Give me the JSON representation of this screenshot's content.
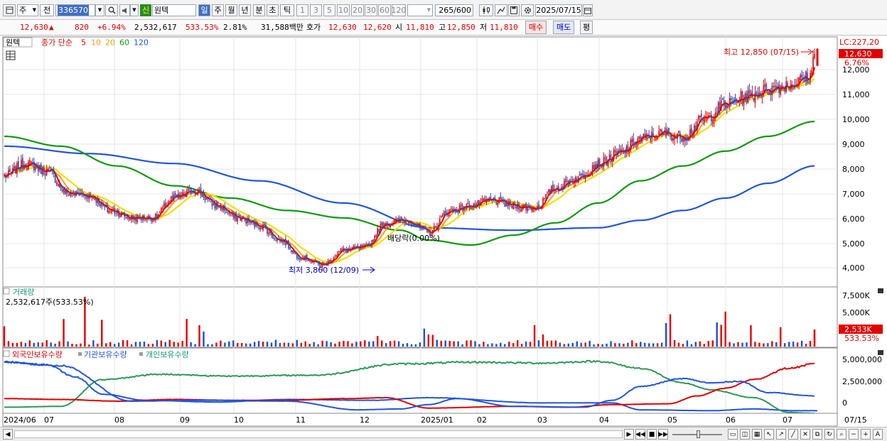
{
  "toolbar": {
    "market": "주",
    "price_type": "전",
    "code": "336570",
    "new_badge": "신",
    "name": "원텍",
    "periods": [
      "일",
      "주",
      "월",
      "년",
      "분",
      "초",
      "틱"
    ],
    "period_selected": "일",
    "intervals": [
      "1",
      "3",
      "5",
      "10",
      "20",
      "30",
      "60",
      "120"
    ],
    "count": "265",
    "count_max": "/600",
    "date": "2025/07/15"
  },
  "quote": {
    "price": "12,630",
    "arrow": "▲",
    "change": "820",
    "change_pct": "+6.94%",
    "volume": "2,532,617",
    "vol_ratio": "533.53%",
    "turnover": "2.81%",
    "amount": "31,588백만",
    "bid_label": "호가",
    "bid1": "12,630",
    "bid2": "12,620",
    "open_label": "시",
    "open": "11,810",
    "high_label": "고",
    "high": "12,850",
    "low_label": "저",
    "low": "11,810",
    "buy_label": "매수",
    "sell_label": "매도",
    "pin_label": "평"
  },
  "chart": {
    "stock_tag": "원텍",
    "ma_title": "종가 단순",
    "ma_periods": [
      {
        "label": "5",
        "color": "#e00000"
      },
      {
        "label": "10",
        "color": "#ff9a1a"
      },
      {
        "label": "20",
        "color": "#e8d800"
      },
      {
        "label": "60",
        "color": "#119911"
      },
      {
        "label": "120",
        "color": "#2255dd"
      }
    ],
    "lc_label": "LC:227,20",
    "price_badge": "12,630",
    "pct_badge": "6.76%",
    "high_annot": "최고 12,850 (07/15)",
    "low_annot": "최저 3,860 (12/09)",
    "div_annot": "배당락(0.00%)",
    "price_ticks": [
      "12,000",
      "11,000",
      "10,000",
      "9,000",
      "8,000",
      "7,000",
      "6,000",
      "5,000",
      "4,000"
    ],
    "vol_title": "거래량",
    "vol_value": "2,532,617주(533.53%)",
    "vol_ticks": [
      "7,500K",
      "5,000K",
      "2,500K"
    ],
    "vol_badge": "2,533K",
    "vol_pct": "533.53%",
    "holders": [
      {
        "label": "외국인보유수량",
        "color": "#e00000"
      },
      {
        "label": "기관보유수량",
        "color": "#2255dd"
      },
      {
        "label": "개인보유수량",
        "color": "#119911"
      }
    ],
    "holder_ticks": [
      "5,000,000",
      "2,500,000",
      "0"
    ],
    "dates": [
      "2024/06",
      "07",
      "08",
      "09",
      "10",
      "11",
      "12",
      "2025/01",
      "02",
      "03",
      "04",
      "05",
      "06",
      "07"
    ],
    "date_right": "07/15"
  },
  "chart_data": {
    "type": "candlestick",
    "series": [
      {
        "name": "5",
        "values_keypoints": [
          [
            0,
            7700
          ],
          [
            15,
            8200
          ],
          [
            30,
            7900
          ],
          [
            45,
            7000
          ],
          [
            60,
            6900
          ],
          [
            75,
            6300
          ],
          [
            90,
            6000
          ],
          [
            105,
            6000
          ],
          [
            120,
            6800
          ],
          [
            135,
            7100
          ],
          [
            150,
            6500
          ],
          [
            165,
            6000
          ],
          [
            180,
            5700
          ],
          [
            195,
            5100
          ],
          [
            210,
            4400
          ],
          [
            225,
            4100
          ],
          [
            240,
            4700
          ],
          [
            255,
            4800
          ],
          [
            270,
            5800
          ],
          [
            285,
            5900
          ],
          [
            300,
            5400
          ],
          [
            315,
            6300
          ],
          [
            330,
            6500
          ],
          [
            345,
            6700
          ],
          [
            360,
            6500
          ],
          [
            375,
            6400
          ],
          [
            390,
            7200
          ],
          [
            405,
            7600
          ],
          [
            420,
            8200
          ],
          [
            435,
            8600
          ],
          [
            450,
            9200
          ],
          [
            465,
            9400
          ],
          [
            480,
            9300
          ],
          [
            495,
            10000
          ],
          [
            510,
            10600
          ],
          [
            525,
            10900
          ],
          [
            540,
            11200
          ],
          [
            555,
            11400
          ],
          [
            570,
            11700
          ],
          [
            573,
            12630
          ]
        ]
      },
      {
        "name": "60",
        "values_keypoints": [
          [
            0,
            9300
          ],
          [
            40,
            8900
          ],
          [
            80,
            8100
          ],
          [
            120,
            7300
          ],
          [
            160,
            6800
          ],
          [
            200,
            6300
          ],
          [
            240,
            6000
          ],
          [
            280,
            5500
          ],
          [
            300,
            5100
          ],
          [
            330,
            4900
          ],
          [
            360,
            5300
          ],
          [
            390,
            5800
          ],
          [
            420,
            6600
          ],
          [
            450,
            7500
          ],
          [
            480,
            8100
          ],
          [
            510,
            8700
          ],
          [
            540,
            9300
          ],
          [
            573,
            9900
          ]
        ]
      },
      {
        "name": "120",
        "values_keypoints": [
          [
            0,
            8900
          ],
          [
            60,
            8600
          ],
          [
            120,
            8200
          ],
          [
            180,
            7500
          ],
          [
            240,
            6600
          ],
          [
            300,
            5600
          ],
          [
            360,
            5500
          ],
          [
            420,
            5600
          ],
          [
            450,
            5900
          ],
          [
            480,
            6300
          ],
          [
            510,
            6800
          ],
          [
            540,
            7400
          ],
          [
            573,
            8100
          ]
        ]
      }
    ],
    "ylim": [
      3600,
      13500
    ],
    "price_high": 12850,
    "price_low": 3860
  }
}
